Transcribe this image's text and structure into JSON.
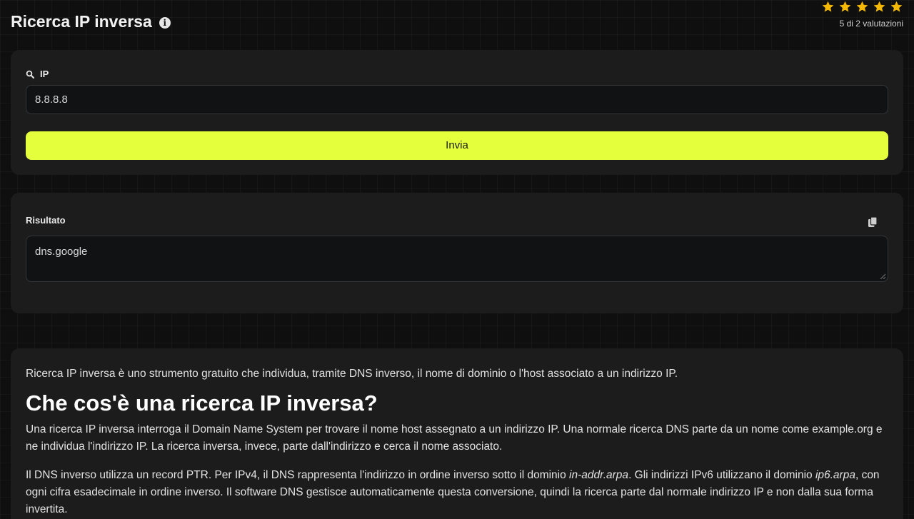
{
  "header": {
    "title": "Ricerca IP inversa",
    "info_icon": "info-circle-icon"
  },
  "rating": {
    "stars": 5,
    "max_stars": 5,
    "star_color": "#f5b800",
    "text": "5 di 2 valutazioni"
  },
  "input_card": {
    "label": "IP",
    "label_icon": "search-icon",
    "ip_value": "8.8.8.8",
    "submit_label": "Invia",
    "accent_color": "#e4ff3c"
  },
  "result_card": {
    "label": "Risultato",
    "copy_icon": "copy-icon",
    "value": "dns.google"
  },
  "article": {
    "intro": "Ricerca IP inversa è uno strumento gratuito che individua, tramite DNS inverso, il nome di dominio o l'host associato a un indirizzo IP.",
    "heading": "Che cos'è una ricerca IP inversa?",
    "p1": "Una ricerca IP inversa interroga il Domain Name System per trovare il nome host assegnato a un indirizzo IP. Una normale ricerca DNS parte da un nome come example.org e ne individua l'indirizzo IP. La ricerca inversa, invece, parte dall'indirizzo e cerca il nome associato.",
    "p2_a": "Il DNS inverso utilizza un record PTR. Per IPv4, il DNS rappresenta l'indirizzo in ordine inverso sotto il dominio ",
    "p2_em1": "in-addr.arpa",
    "p2_b": ". Gli indirizzi IPv6 utilizzano il dominio ",
    "p2_em2": "ip6.arpa",
    "p2_c": ", con ogni cifra esadecimale in ordine inverso. Il software DNS gestisce automaticamente questa conversione, quindi la ricerca parte dal normale indirizzo IP e non dalla sua forma invertita."
  }
}
